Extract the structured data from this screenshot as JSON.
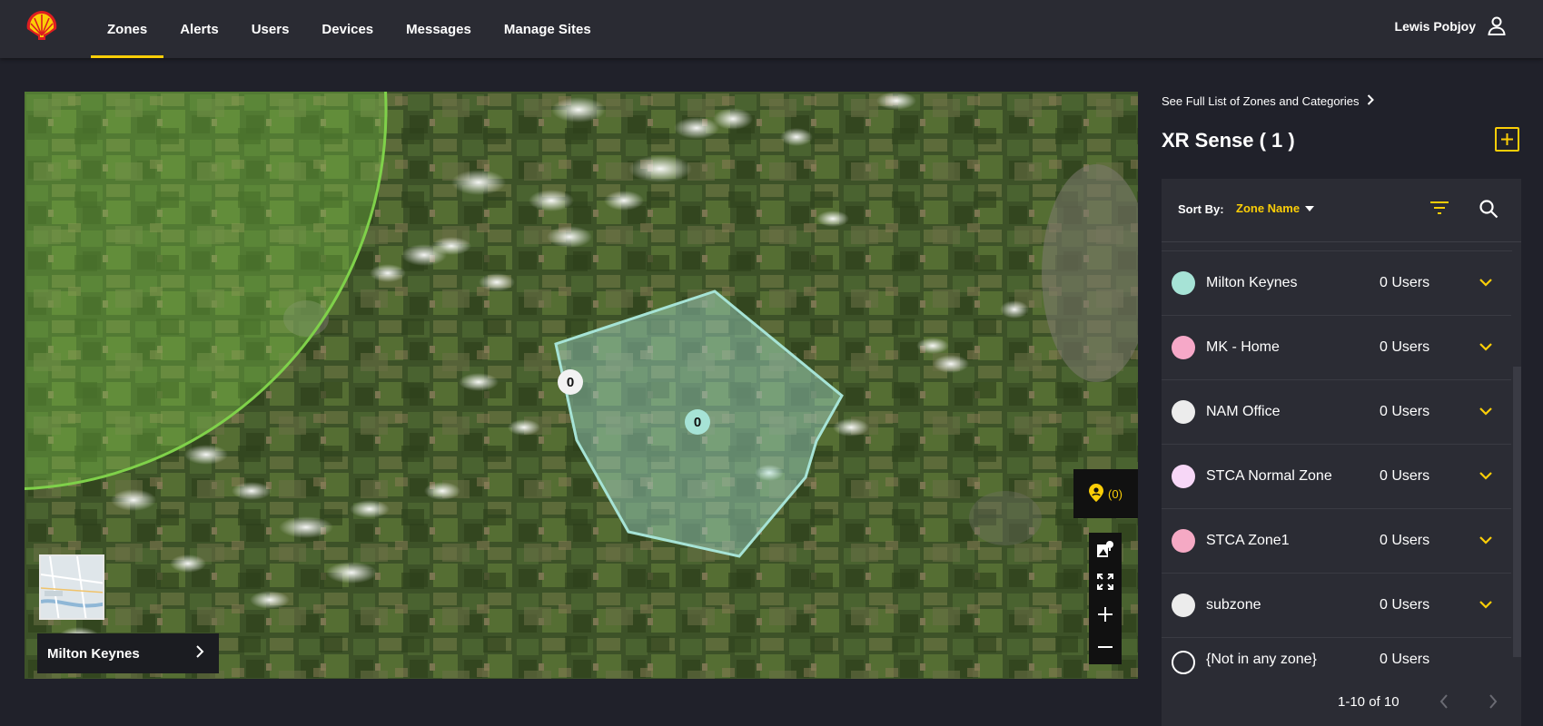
{
  "app": {
    "logo": "shell-logo",
    "user_name": "Lewis Pobjoy",
    "user_icon": "person-icon"
  },
  "nav": {
    "items": [
      {
        "label": "Zones",
        "active": true
      },
      {
        "label": "Alerts",
        "active": false
      },
      {
        "label": "Users",
        "active": false
      },
      {
        "label": "Devices",
        "active": false
      },
      {
        "label": "Messages",
        "active": false
      },
      {
        "label": "Manage Sites",
        "active": false
      }
    ]
  },
  "map": {
    "cluster_white_count": "0",
    "cluster_teal_count": "0",
    "pin_count": "(0)",
    "current_zone": "Milton Keynes",
    "controls": [
      "layers-icon",
      "fullscreen-icon",
      "zoom-in-icon",
      "zoom-out-icon"
    ]
  },
  "panel": {
    "see_full_link": "See Full List of Zones and Categories",
    "title": "XR Sense ( 1 )",
    "sort_label": "Sort By:",
    "sort_value": "Zone Name",
    "zones": [
      {
        "name": "Milton Keynes",
        "users": "0 Users",
        "color": "#a6e3d6"
      },
      {
        "name": "MK - Home",
        "users": "0 Users",
        "color": "#f6a8c8"
      },
      {
        "name": "NAM Office",
        "users": "0 Users",
        "color": "#ececec"
      },
      {
        "name": "STCA Normal Zone",
        "users": "0 Users",
        "color": "#f7d7f7"
      },
      {
        "name": "STCA Zone1",
        "users": "0 Users",
        "color": "#f5a9c4"
      },
      {
        "name": "subzone",
        "users": "0 Users",
        "color": "#ececec"
      },
      {
        "name": "{Not in any zone}",
        "users": "0 Users",
        "color": "transparent"
      }
    ],
    "pagination": "1-10 of 10"
  },
  "colors": {
    "accent": "#fbce07",
    "background": "#20212a",
    "topbar": "#2a2b33",
    "zone_teal": "#a6e3d6",
    "circle_green": "#7fd14a"
  }
}
